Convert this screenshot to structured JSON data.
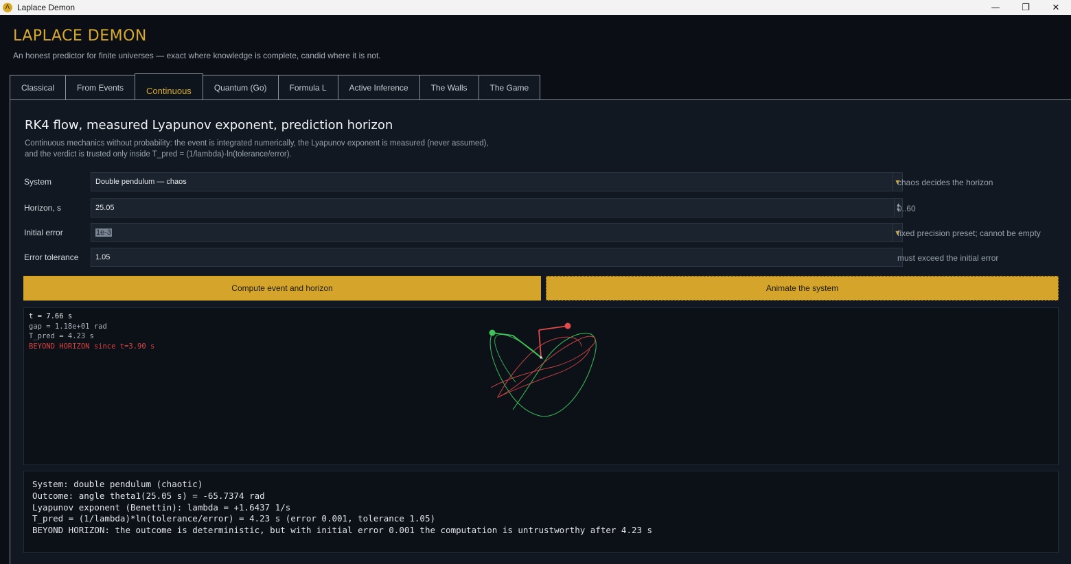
{
  "window": {
    "title": "Laplace Demon",
    "icon_glyph": "Λ",
    "minimize_glyph": "—",
    "restore_glyph": "❐",
    "close_glyph": "✕"
  },
  "header": {
    "title": "LAPLACE  DEMON",
    "subtitle": "An honest predictor for finite universes — exact where knowledge is complete, candid where it is not."
  },
  "tabs": [
    {
      "label": "Classical"
    },
    {
      "label": "From Events"
    },
    {
      "label": "Continuous",
      "active": true
    },
    {
      "label": "Quantum (Go)"
    },
    {
      "label": "Formula L"
    },
    {
      "label": "Active Inference"
    },
    {
      "label": "The Walls"
    },
    {
      "label": "The Game"
    }
  ],
  "section": {
    "title": "RK4 flow, measured Lyapunov exponent, prediction horizon",
    "description": "Continuous mechanics without probability: the event is integrated numerically, the Lyapunov exponent is measured (never assumed), and the verdict is trusted only inside T_pred = (1/lambda)·ln(tolerance/error)."
  },
  "form": {
    "system": {
      "label": "System",
      "value": "Double pendulum — chaos",
      "hint": "chaos decides the horizon"
    },
    "horizon": {
      "label": "Horizon, s",
      "value": "25.05",
      "hint": "0..60"
    },
    "initial_error": {
      "label": "Initial error",
      "value": "1e-3",
      "hint": "fixed precision preset; cannot be empty"
    },
    "tolerance": {
      "label": "Error tolerance",
      "value": "1.05",
      "hint": "must exceed the initial error"
    }
  },
  "buttons": {
    "compute": "Compute event and horizon",
    "animate": "Animate the system"
  },
  "readout": {
    "t": "t =  7.66 s",
    "gap": "gap = 1.18e+01 rad",
    "tpred": "T_pred = 4.23 s",
    "beyond": "BEYOND HORIZON since t=3.90 s"
  },
  "colors": {
    "accent": "#d9a92a",
    "pendulum_green": "#3ec45a",
    "pendulum_red": "#e24b4b",
    "warning": "#d64545"
  },
  "output": {
    "lines": [
      "System: double pendulum (chaotic)",
      "Outcome: angle theta1(25.05 s) = -65.7374 rad",
      "Lyapunov exponent (Benettin): lambda = +1.6437 1/s",
      "T_pred = (1/lambda)*ln(tolerance/error) = 4.23 s (error 0.001, tolerance 1.05)",
      "BEYOND HORIZON: the outcome is deterministic, but with initial error 0.001 the computation is untrustworthy after 4.23 s"
    ]
  }
}
